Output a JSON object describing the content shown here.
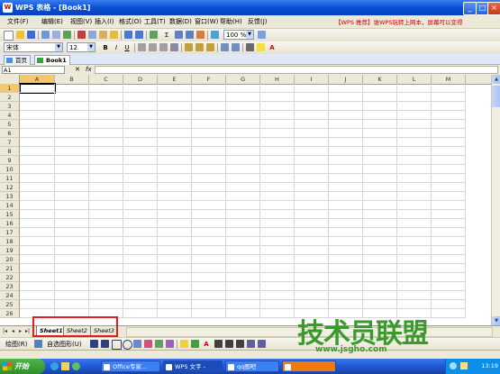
{
  "window": {
    "title": "WPS 表格 - [Book1]",
    "app_icon_letter": "W",
    "minimize_label": "_",
    "maximize_label": "□",
    "close_label": "×"
  },
  "menu": {
    "items": [
      "文件(F)",
      "编辑(E)",
      "视图(V)",
      "插入(I)",
      "格式(O)",
      "工具(T)",
      "数据(D)",
      "窗口(W)",
      "帮助(H)",
      "反馈(J)"
    ],
    "promo": "【WPS 推荐】谁WPS玩转上网本，屏幕可以变得"
  },
  "toolbar": {
    "zoom": "100 %",
    "font_name": "宋体",
    "font_size": "12",
    "bold": "B",
    "italic": "I",
    "underline": "U",
    "autosum": "Σ",
    "font_color_glyph": "A"
  },
  "doc_tabs": [
    "首页",
    "Book1"
  ],
  "formula_bar": {
    "name_box": "A1",
    "fx": "fx",
    "content": ""
  },
  "grid": {
    "columns": [
      "A",
      "B",
      "C",
      "D",
      "E",
      "F",
      "G",
      "H",
      "I",
      "J",
      "K",
      "L",
      "M"
    ],
    "rows": [
      "1",
      "2",
      "3",
      "4",
      "5",
      "6",
      "7",
      "8",
      "9",
      "10",
      "11",
      "12",
      "13",
      "14",
      "15",
      "16",
      "17",
      "18",
      "19",
      "20",
      "21",
      "22",
      "23",
      "24",
      "25",
      "26"
    ],
    "active_cell": "A1"
  },
  "sheets": {
    "nav": [
      "|◂",
      "◂",
      "▸",
      "▸|"
    ],
    "tabs": [
      "Sheet1",
      "Sheet2",
      "Sheet3"
    ],
    "active": "Sheet1"
  },
  "drawbar": {
    "draw_label": "绘图(R)",
    "autoshape_label": "自选图形(U)"
  },
  "taskbar": {
    "start_label": "开始",
    "tasks": [
      "Office专家...",
      "WPS 文字 -",
      "qq图吧"
    ],
    "clock": "13:19"
  },
  "watermark": {
    "text": "技术员联盟",
    "url": "www.jsgho.com"
  },
  "colors": {
    "title_blue": "#0a4fd6",
    "selected_header": "#f6c66c",
    "highlight_red": "#e02020",
    "watermark_green": "#3a9a2e"
  }
}
